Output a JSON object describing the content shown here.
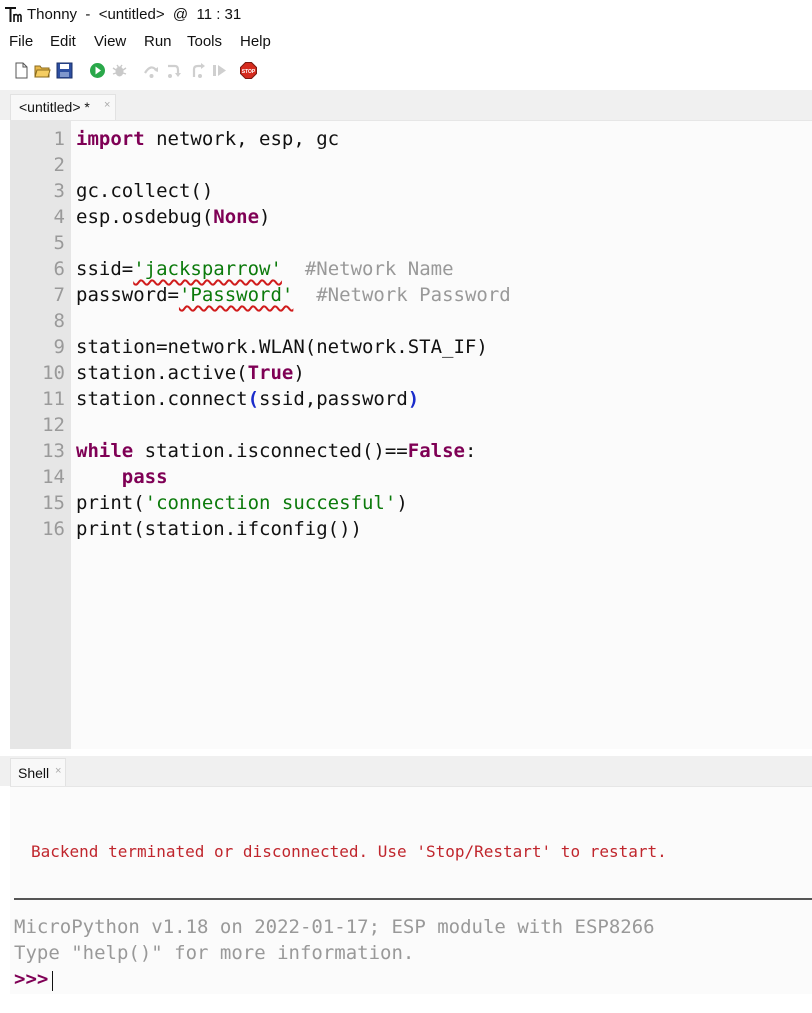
{
  "window": {
    "title": "Thonny  -  <untitled>  @  11 : 31"
  },
  "menu": [
    "File",
    "Edit",
    "View",
    "Run",
    "Tools",
    "Help"
  ],
  "toolbar": {
    "icons": [
      "new-file-icon",
      "open-file-icon",
      "save-icon",
      "run-icon",
      "debug-icon",
      "step-over-icon",
      "step-into-icon",
      "step-out-icon",
      "resume-icon",
      "stop-icon"
    ],
    "stop_label": "STOP"
  },
  "editor": {
    "tab_label": "<untitled> *",
    "tab_close": "×",
    "line_numbers": [
      "1",
      "2",
      "3",
      "4",
      "5",
      "6",
      "7",
      "8",
      "9",
      "10",
      "11",
      "12",
      "13",
      "14",
      "15",
      "16"
    ],
    "code": {
      "l1_kw": "import",
      "l1_rest": " network, esp, gc",
      "l3": "gc.collect()",
      "l4_a": "esp.osdebug(",
      "l4_kw": "None",
      "l4_b": ")",
      "l6_a": "ssid=",
      "l6_str": "'jacksparrow'",
      "l6_gap": "  ",
      "l6_cm": "#Network Name",
      "l7_a": "password=",
      "l7_str": "'Password'",
      "l7_gap": "  ",
      "l7_cm": "#Network Password",
      "l9": "station=network.WLAN(network.STA_IF)",
      "l10_a": "station.active(",
      "l10_kw": "True",
      "l10_b": ")",
      "l11_a": "station.connect",
      "l11_p1": "(",
      "l11_b": "ssid,password",
      "l11_p2": ")",
      "l13_kw1": "while",
      "l13_a": " station.isconnected()==",
      "l13_kw2": "False",
      "l13_b": ":",
      "l14_indent": "    ",
      "l14_kw": "pass",
      "l15_a": "print(",
      "l15_str": "'connection succesful'",
      "l15_b": ")",
      "l16": "print(station.ifconfig())"
    }
  },
  "shell": {
    "tab_label": "Shell",
    "tab_close": "×",
    "error": "Backend terminated or disconnected. Use 'Stop/Restart' to restart.",
    "info_line1": "MicroPython v1.18 on 2022-01-17; ESP module with ESP8266",
    "info_line2": "Type \"help()\" for more information.",
    "prompt": ">>>"
  },
  "colors": {
    "keyword": "#7f0055",
    "string": "#0b7a0b",
    "comment": "#999999",
    "error": "#c0262d",
    "paren_match": "#1a2ccb"
  }
}
